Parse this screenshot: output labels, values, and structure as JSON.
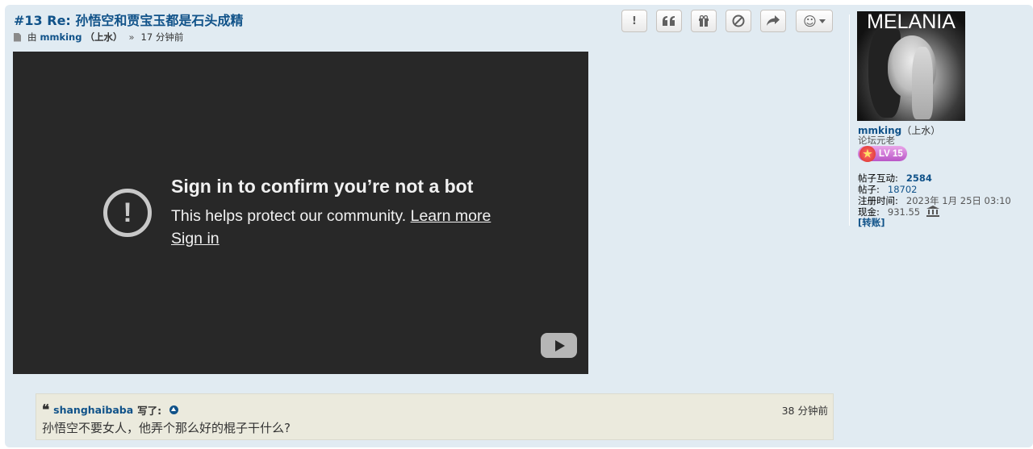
{
  "post": {
    "number": "#13",
    "title": "Re: 孙悟空和贾宝玉都是石头成精",
    "by_label": "由",
    "author": "mmking",
    "author_rank": "（上水）",
    "separator": "»",
    "time": "17 分钟前"
  },
  "actions": [
    {
      "name": "report",
      "icon": "exclamation-icon",
      "glyph": "!"
    },
    {
      "name": "quote",
      "icon": "quote-icon",
      "glyph": "❝"
    },
    {
      "name": "gift",
      "icon": "gift-icon",
      "glyph": ""
    },
    {
      "name": "block",
      "icon": "block-icon",
      "glyph": ""
    },
    {
      "name": "share",
      "icon": "share-icon",
      "glyph": ""
    },
    {
      "name": "react",
      "icon": "smiley-icon",
      "glyph": "☺"
    }
  ],
  "video": {
    "title": "Sign in to confirm you’re not a bot",
    "text": "This helps protect our community.",
    "learn_more": "Learn more",
    "sign_in": "Sign in"
  },
  "sidebar": {
    "avatar_text": "MELANIA",
    "username": "mmking",
    "user_rank": "（上水）",
    "rank_title": "论坛元老",
    "level": "LV 15",
    "stats": {
      "interactions_label": "帖子互动:",
      "interactions_value": "2584",
      "posts_label": "帖子:",
      "posts_value": "18702",
      "joined_label": "注册时间:",
      "joined_value": "2023年 1月 25日 03:10",
      "cash_label": "现金:",
      "cash_value": "931.55"
    },
    "transfer": "[转账]"
  },
  "quote": {
    "user": "shanghaibaba",
    "wrote": "写了:",
    "time": "38 分钟前",
    "body": "孙悟空不要女人，他弄个那么好的棍子干什么?"
  },
  "colors": {
    "background": "#e1ebf2",
    "link": "#105289",
    "video_bg": "#282828",
    "quote_bg": "#ebeadd"
  }
}
